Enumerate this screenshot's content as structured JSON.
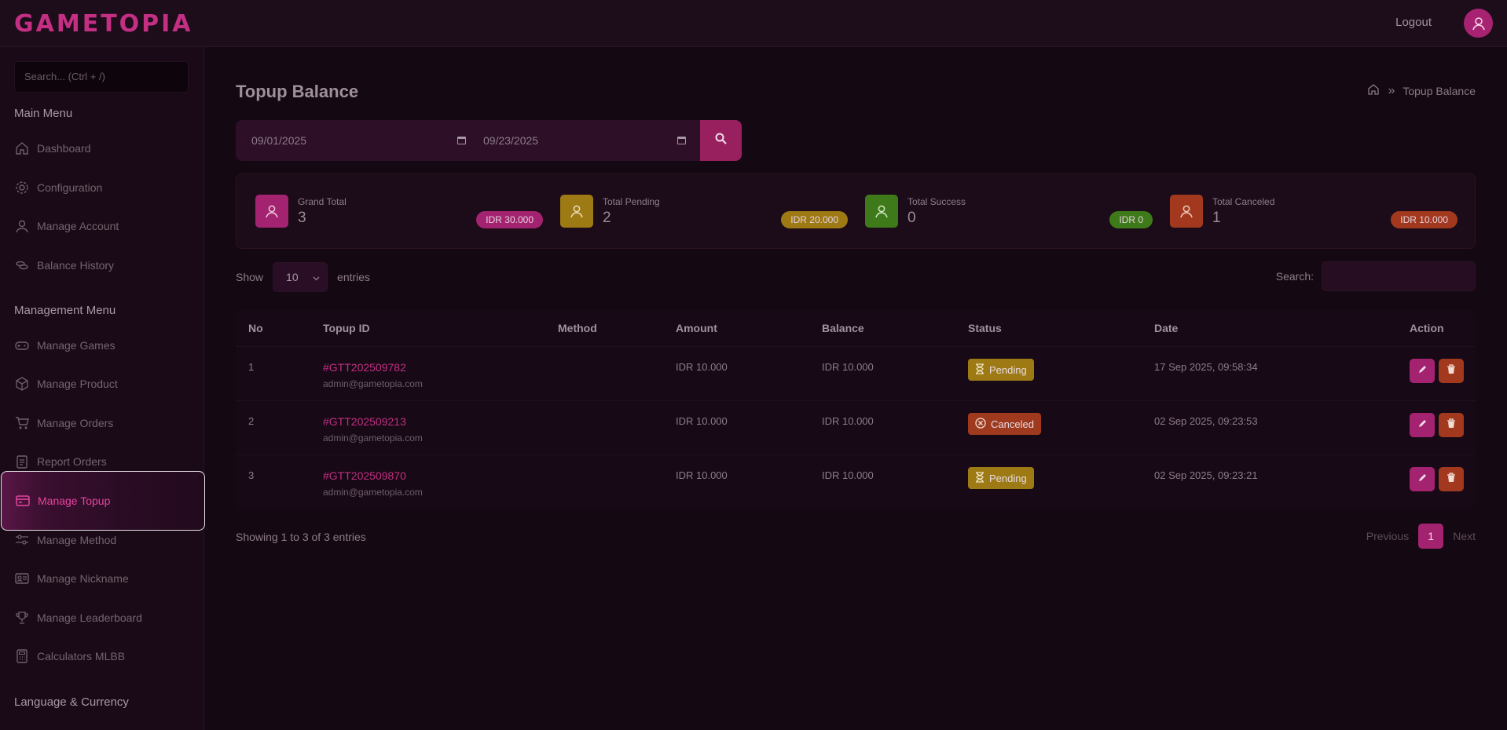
{
  "app": {
    "brand": "GAMETOPIA",
    "logout": "Logout"
  },
  "sidebar": {
    "search_placeholder": "Search... (Ctrl + /)",
    "main_menu_title": "Main Menu",
    "main_items": [
      {
        "label": "Dashboard",
        "icon": "home-icon"
      },
      {
        "label": "Configuration",
        "icon": "gear-icon"
      },
      {
        "label": "Manage Account",
        "icon": "user-icon"
      },
      {
        "label": "Balance History",
        "icon": "coins-icon"
      }
    ],
    "management_menu_title": "Management Menu",
    "management_items": [
      {
        "label": "Manage Games",
        "icon": "gamepad-icon"
      },
      {
        "label": "Manage Product",
        "icon": "box-icon"
      },
      {
        "label": "Manage Orders",
        "icon": "cart-icon"
      },
      {
        "label": "Report Orders",
        "icon": "clipboard-icon"
      },
      {
        "label": "Manage Topup",
        "icon": "wallet-icon",
        "active": true
      },
      {
        "label": "Manage Method",
        "icon": "sliders-icon"
      },
      {
        "label": "Manage Nickname",
        "icon": "id-card-icon"
      },
      {
        "label": "Manage Leaderboard",
        "icon": "trophy-icon"
      },
      {
        "label": "Calculators MLBB",
        "icon": "calculator-icon"
      }
    ],
    "language_title": "Language & Currency"
  },
  "page": {
    "title": "Topup Balance",
    "breadcrumb": {
      "separator": "»",
      "current": "Topup Balance"
    }
  },
  "filters": {
    "date_from": "09/01/2025",
    "date_to": "09/23/2025"
  },
  "stats": [
    {
      "label": "Grand Total",
      "count": "3",
      "amount": "IDR 30.000",
      "color": "#a42370"
    },
    {
      "label": "Total Pending",
      "count": "2",
      "amount": "IDR 20.000",
      "color": "#9e7a14"
    },
    {
      "label": "Total Success",
      "count": "0",
      "amount": "IDR 0",
      "color": "#3f7a1a"
    },
    {
      "label": "Total Canceled",
      "count": "1",
      "amount": "IDR 10.000",
      "color": "#a2391e"
    }
  ],
  "table_controls": {
    "show": "Show",
    "entries_value": "10",
    "entries": "entries",
    "search_label": "Search:"
  },
  "table": {
    "headers": [
      "No",
      "Topup ID",
      "Method",
      "Amount",
      "Balance",
      "Status",
      "Date",
      "Action"
    ],
    "rows": [
      {
        "no": "1",
        "topup_id": "#GTT202509782",
        "email": "admin@gametopia.com",
        "method": "",
        "amount": "IDR 10.000",
        "balance": "IDR 10.000",
        "status": "Pending",
        "date": "17 Sep 2025, 09:58:34"
      },
      {
        "no": "2",
        "topup_id": "#GTT202509213",
        "email": "admin@gametopia.com",
        "method": "",
        "amount": "IDR 10.000",
        "balance": "IDR 10.000",
        "status": "Canceled",
        "date": "02 Sep 2025, 09:23:53"
      },
      {
        "no": "3",
        "topup_id": "#GTT202509870",
        "email": "admin@gametopia.com",
        "method": "",
        "amount": "IDR 10.000",
        "balance": "IDR 10.000",
        "status": "Pending",
        "date": "02 Sep 2025, 09:23:21"
      }
    ]
  },
  "footer": {
    "showing": "Showing 1 to 3 of 3 entries",
    "previous": "Previous",
    "current_page": "1",
    "next": "Next"
  }
}
